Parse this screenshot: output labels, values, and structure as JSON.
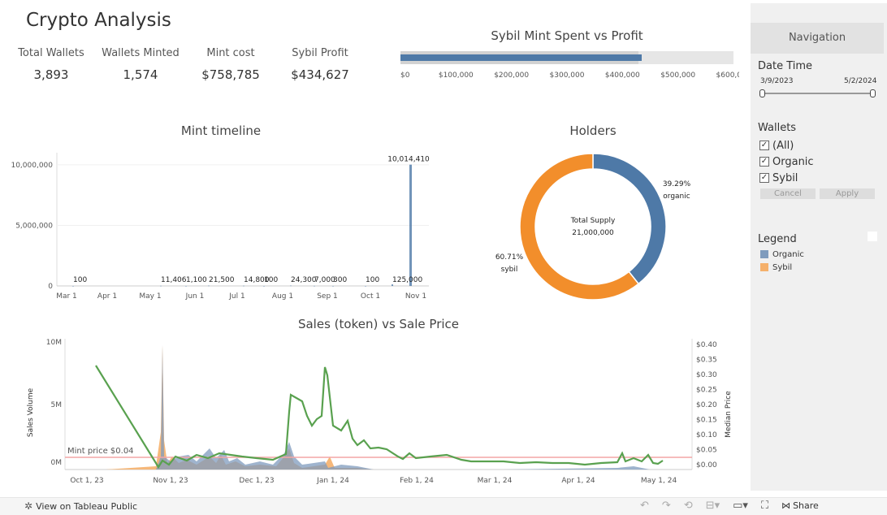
{
  "header": {
    "title": "Crypto Analysis"
  },
  "kpis": [
    {
      "label": "Total Wallets",
      "value": "3,893"
    },
    {
      "label": "Wallets Minted",
      "value": "1,574"
    },
    {
      "label": "Mint cost",
      "value": "$758,785"
    },
    {
      "label": "Sybil Profit",
      "value": "$434,627"
    }
  ],
  "sybil_chart": {
    "title": "Sybil Mint Spent vs Profit",
    "ticks": [
      "$0",
      "$100,000",
      "$200,000",
      "$300,000",
      "$400,000",
      "$500,000",
      "$600,000"
    ]
  },
  "mint_timeline": {
    "title": "Mint timeline",
    "y_ticks": [
      "10,000,000",
      "5,000,000",
      "0"
    ],
    "x_ticks": [
      "Mar 1",
      "Apr 1",
      "May 1",
      "Jun 1",
      "Jul 1",
      "Aug 1",
      "Sep 1",
      "Oct 1",
      "Nov 1"
    ],
    "labels": [
      "100",
      "11,406",
      "1,100",
      "21,500",
      "14,800",
      "100",
      "24,300",
      "7,000",
      "300",
      "100",
      "125,000",
      "10,014,410"
    ]
  },
  "holders": {
    "title": "Holders",
    "center_line1": "Total Supply",
    "center_line2": "21,000,000",
    "organic_pct": "39.29%",
    "organic_label": "organic",
    "sybil_pct": "60.71%",
    "sybil_label": "sybil"
  },
  "sales": {
    "title": "Sales (token) vs Sale Price",
    "y_left_label": "Sales Volume",
    "y_right_label": "Median Price",
    "y_left_ticks": [
      "10M",
      "5M",
      "0M"
    ],
    "y_right_ticks": [
      "$0.40",
      "$0.35",
      "$0.30",
      "$0.25",
      "$0.20",
      "$0.15",
      "$0.10",
      "$0.05",
      "$0.00"
    ],
    "x_ticks": [
      "Oct 1, 23",
      "Nov 1, 23",
      "Dec 1, 23",
      "Jan 1, 24",
      "Feb 1, 24",
      "Mar 1, 24",
      "Apr 1, 24",
      "May 1, 24"
    ],
    "mint_price_label": "Mint price $0.04"
  },
  "panel": {
    "nav_title": "Navigation",
    "date_label": "Date Time",
    "date_start": "3/9/2023",
    "date_end": "5/2/2024",
    "wallets_label": "Wallets",
    "options": [
      "(All)",
      "Organic",
      "Sybil"
    ],
    "cancel": "Cancel",
    "apply": "Apply",
    "legend_label": "Legend",
    "legend_items": [
      "Organic",
      "Sybil"
    ]
  },
  "toolbar": {
    "view_label": "View on Tableau Public",
    "share_label": "Share"
  },
  "colors": {
    "organic": "#4e79a7",
    "sybil": "#f28e2b",
    "price_line": "#59a14f",
    "mint_line": "#f4a6a6"
  },
  "chart_data": [
    {
      "type": "bar",
      "title": "Sybil Mint Spent vs Profit",
      "series": [
        {
          "values": [
            434627
          ]
        }
      ],
      "xlim": [
        0,
        600000
      ]
    },
    {
      "type": "bar",
      "title": "Mint timeline",
      "data_labels": [
        "100",
        "11,406",
        "1,100",
        "21,500",
        "14,800",
        "100",
        "24,300",
        "7,000",
        "300",
        "100",
        "125,000",
        "10,014,410"
      ],
      "values": [
        100,
        11406,
        1100,
        21500,
        14800,
        100,
        24300,
        7000,
        300,
        100,
        125000,
        10014410
      ],
      "ylim": [
        0,
        11000000
      ]
    },
    {
      "type": "pie",
      "title": "Holders",
      "categories": [
        "organic",
        "sybil"
      ],
      "values": [
        39.29,
        60.71
      ]
    },
    {
      "type": "line",
      "title": "Sales (token) vs Sale Price",
      "ylabel": "Sales Volume",
      "y2label": "Median Price",
      "ylim": [
        0,
        10000000
      ],
      "y2lim": [
        0,
        0.4
      ]
    }
  ]
}
